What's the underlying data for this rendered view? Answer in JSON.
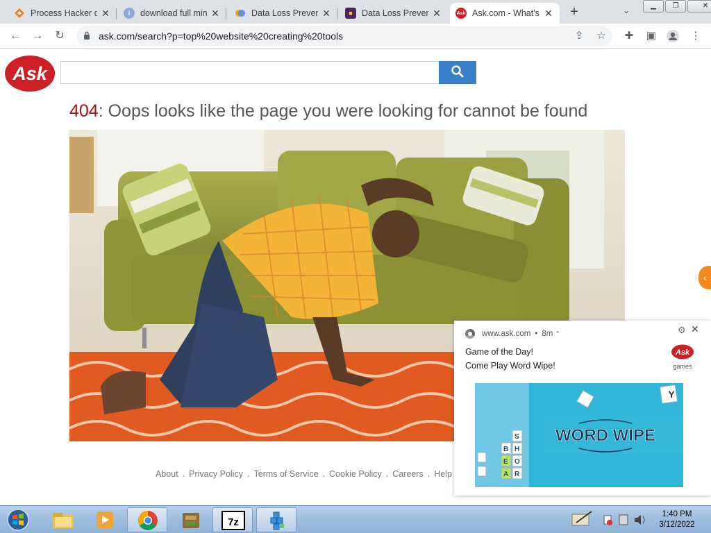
{
  "browser": {
    "tabs": [
      {
        "title": "Process Hacker do",
        "favicon_color": "#e67e22"
      },
      {
        "title": "download full min",
        "favicon_color": "#7d9bd6"
      },
      {
        "title": "Data Loss Prevent",
        "favicon_color": "#f3a11c"
      },
      {
        "title": "Data Loss Prevent",
        "favicon_color": "#4a2359"
      },
      {
        "title": "Ask.com - What's",
        "favicon_color": "#cc1f26",
        "active": true
      }
    ],
    "new_tab": "+",
    "url": "ask.com/search?p=top%20website%20creating%20tools"
  },
  "ask": {
    "logo_text": "Ask",
    "search_value": "",
    "error_code": "404",
    "error_message": ": Oops looks like the page you were looking for cannot be found"
  },
  "footer": {
    "links": [
      "About",
      "Privacy Policy",
      "Terms of Service",
      "Cookie Policy",
      "Careers",
      "Help"
    ],
    "separator": "."
  },
  "notification": {
    "site": "www.ask.com",
    "age": "8m",
    "title": "Game of the Day!",
    "body": "Come Play Word Wipe!",
    "brand_logo_text": "Ask",
    "brand_sub": "games",
    "image_title": "WORD WIPE"
  },
  "taskbar": {
    "time": "1:40 PM",
    "date": "3/12/2022"
  },
  "colors": {
    "ask_red": "#cc1f26",
    "search_blue": "#3a7fc9",
    "orange_accent": "#f08a1c"
  }
}
